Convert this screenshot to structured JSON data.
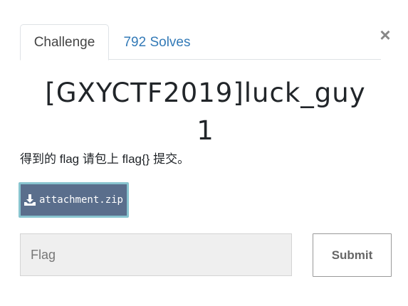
{
  "tabs": {
    "challenge_label": "Challenge",
    "solves_label": "792 Solves"
  },
  "close_symbol": "×",
  "challenge": {
    "title": "[GXYCTF2019]luck_guy",
    "points": "1",
    "description": "得到的 flag 请包上 flag{} 提交。"
  },
  "attachment": {
    "icon": "download-icon",
    "filename": "attachment.zip"
  },
  "flag_form": {
    "placeholder": "Flag",
    "submit_label": "Submit"
  },
  "colors": {
    "link": "#337ab7",
    "attachment_bg": "#5a6e8c",
    "attachment_border": "#88c4cf",
    "input_bg": "#efefef"
  }
}
